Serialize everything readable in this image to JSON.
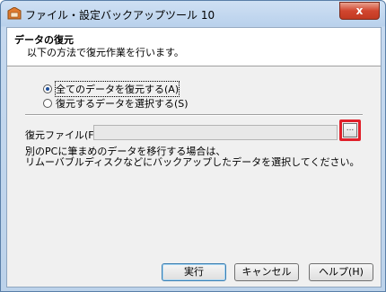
{
  "window": {
    "title": "ファイル・設定バックアップツール 10",
    "close_glyph": "x"
  },
  "header": {
    "title": "データの復元",
    "subtitle": "以下の方法で復元作業を行います。"
  },
  "options": [
    {
      "label": "全てのデータを復元する(A)",
      "checked": true
    },
    {
      "label": "復元するデータを選択する(S)",
      "checked": false
    }
  ],
  "file": {
    "label": "復元ファイル(F)",
    "value": "",
    "browse_label": "..."
  },
  "note": {
    "line1": "別のPCに筆まめのデータを移行する場合は、",
    "line2": "リムーバブルディスクなどにバックアップしたデータを選択してください。"
  },
  "buttons": {
    "run": "実行",
    "cancel": "キャンセル",
    "help": "ヘルプ(H)"
  },
  "colors": {
    "highlight": "#e0202a",
    "close_button": "#c23a22"
  }
}
